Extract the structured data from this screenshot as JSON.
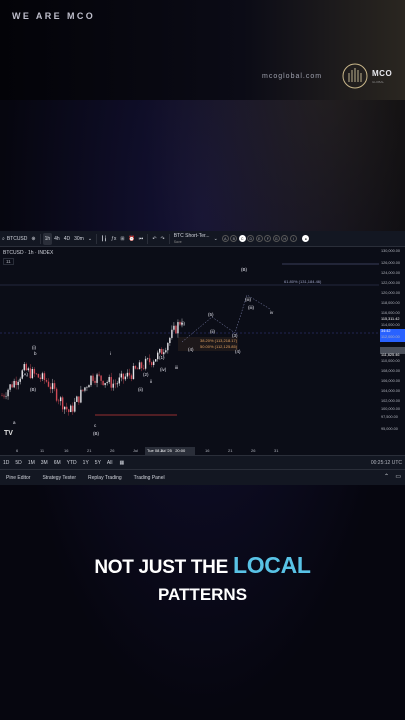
{
  "banner": {
    "tagline": "WE ARE MCO",
    "website": "mcoglobal.com",
    "brand": "MCO",
    "brand_sub": "GLOBAL"
  },
  "toolbar": {
    "symbol": "BTCUSD",
    "intervals": [
      "1h",
      "4h",
      "4D",
      "30m"
    ],
    "script_name": "BTC Short-Ter...",
    "script_sub": "Save",
    "circle_letters": [
      "A",
      "B",
      "C",
      "D",
      "E",
      "F",
      "G",
      "H",
      "I"
    ],
    "selected_letter": "C"
  },
  "chart": {
    "symbol_line": "BTCUSD · 1h · INDEX",
    "indicator_badge": "11",
    "price_ticks": [
      "130,000.00",
      "126,000.00",
      "124,000.00",
      "122,000.00",
      "120,000.00",
      "118,000.00",
      "116,000.00",
      "115,311.42",
      "114,000.00",
      "112,000.00",
      "111,625.46",
      "110,000.00",
      "108,000.00",
      "106,000.00",
      "104,000.00",
      "102,000.00",
      "100,000.00",
      "97,500.00",
      "95,000.00"
    ],
    "current_price": "115,311.42",
    "current_price_sub": "34:42",
    "level_price": "111,625.46",
    "date_ticks": [
      "6",
      "11",
      "16",
      "21",
      "26",
      "Jul",
      "11",
      "16",
      "21",
      "26",
      "31"
    ],
    "highlighted_date": "Tue 08 Jul '25   20:00",
    "fib_label": "61.80% (131,184.46)",
    "fib_box_1": "38.20% (113,218.17)",
    "fib_box_2": "50.00% (112,125.85)",
    "wave_labels": [
      "(B)",
      "(A)",
      "(B)",
      "a",
      "(i)",
      "b",
      "c",
      "(B)",
      "(1)",
      "(ii)",
      "i",
      "ii",
      "iii",
      "(i)",
      "(4)",
      "(ii)",
      "(iii)",
      "(2)",
      "(5)",
      "(3)",
      "(4)",
      "(iii)",
      "iv",
      "(iv)"
    ],
    "logo": "TV"
  },
  "timeframes": {
    "items": [
      "1D",
      "5D",
      "1M",
      "3M",
      "6M",
      "YTD",
      "1Y",
      "5Y",
      "All"
    ],
    "clock": "00:25:12 UTC"
  },
  "panels": {
    "items": [
      "Pine Editor",
      "Strategy Tester",
      "Replay Trading",
      "Trading Panel"
    ]
  },
  "caption": {
    "line1_a": "NOT JUST THE",
    "line1_highlight": "LOCAL",
    "line2": "PATTERNS"
  },
  "chart_data": {
    "type": "line",
    "title": "BTCUSD · 1h · INDEX",
    "xlabel": "",
    "ylabel": "",
    "x": [
      "Jun 6",
      "Jun 11",
      "Jun 16",
      "Jun 21",
      "Jun 26",
      "Jul 1",
      "Jul 6",
      "Jul 8",
      "Jul 11"
    ],
    "series": [
      {
        "values": [
          104000,
          108500,
          106500,
          101000,
          107500,
          106000,
          108500,
          111200,
          117500
        ]
      }
    ],
    "ylim": [
      95000,
      130000
    ],
    "grid": false
  }
}
